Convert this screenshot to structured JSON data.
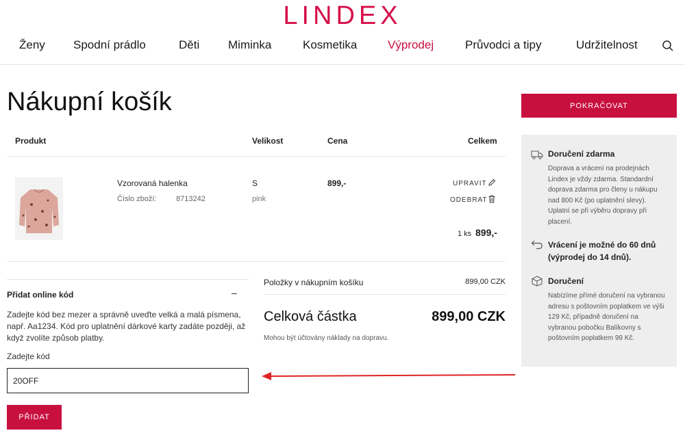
{
  "brand": {
    "logo": "LINDEX",
    "accent": "#c8103f"
  },
  "nav": {
    "items": [
      "Ženy",
      "Spodní prádlo",
      "Děti",
      "Miminka",
      "Kosmetika",
      "Výprodej",
      "Průvodci a tipy",
      "Udržitelnost"
    ],
    "search_icon": "search-icon"
  },
  "page": {
    "title": "Nákupní košík"
  },
  "cart": {
    "columns": {
      "product": "Produkt",
      "size": "Velikost",
      "price": "Cena",
      "total": "Celkem"
    },
    "items": [
      {
        "name": "Vzorovaná halenka",
        "sku_label": "Číslo zboží:",
        "sku": "8713242",
        "size": "S",
        "color": "pink",
        "price": "899,-",
        "edit_label": "UPRAVIT",
        "remove_label": "ODEBRAT",
        "qty": "1 ks",
        "line_total": "899,-"
      }
    ]
  },
  "promo": {
    "heading": "Přidat online kód",
    "toggle": "–",
    "description": "Zadejte kód bez mezer a správně uveďte velká a malá písmena, např. Aa1234. Kód pro uplatnění dárkové karty zadáte později, až když zvolíte způsob platby.",
    "input_label": "Zadejte kód",
    "input_value": "20OFF",
    "button": "PŘIDAT"
  },
  "summary": {
    "items_label": "Položky v nákupním košíku",
    "items_value": "899,00 CZK",
    "total_label": "Celková částka",
    "total_value": "899,00 CZK",
    "note": "Mohou být účtovány náklady na dopravu."
  },
  "sidebar": {
    "continue_button": "POKRAČOVAT",
    "info": [
      {
        "icon": "truck-icon",
        "title": "Doručení zdarma",
        "text": "Doprava a vrácení na prodejnách Lindex je vždy zdarma. Standardní doprava zdarma pro členy u nákupu nad 800 Kč (po uplatnění slevy). Uplatní se při výběru dopravy při placení."
      },
      {
        "icon": "return-arrow-icon",
        "title": "Vrácení je možné do 60 dnů (výprodej do 14 dnů).",
        "text": ""
      },
      {
        "icon": "package-icon",
        "title": "Doručení",
        "text": "Nabízíme přímé doručení na vybranou adresu s poštovním poplatkem ve výši 129 Kč, případně doručení na vybranou pobočku Balíkovny s poštovním poplatkem 99 Kč."
      }
    ]
  }
}
